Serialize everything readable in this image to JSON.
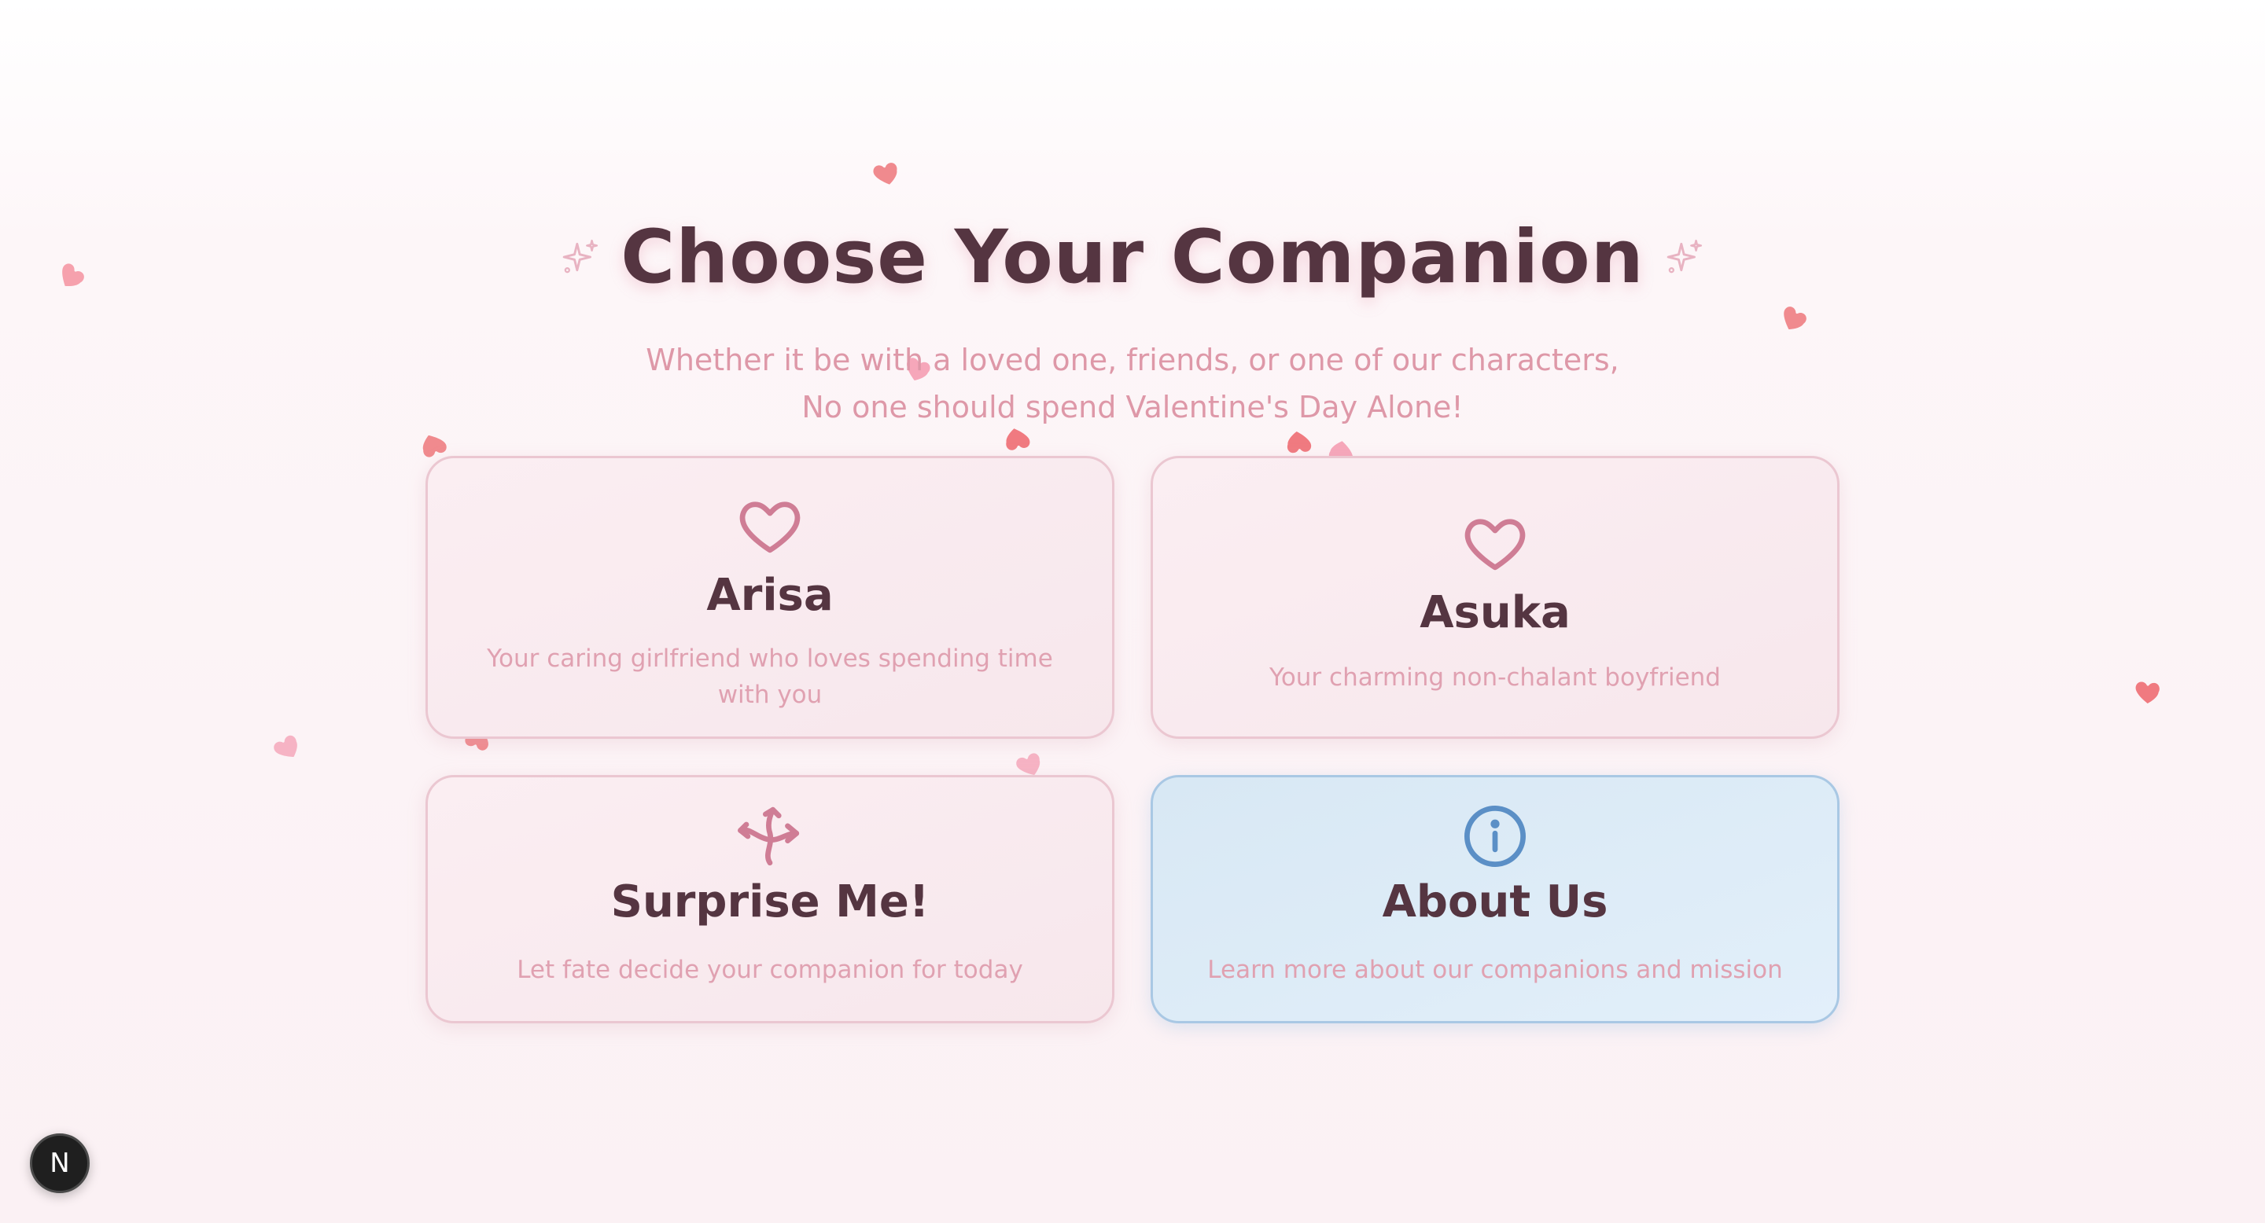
{
  "header": {
    "title": "Choose Your Companion",
    "subtitle_line1": "Whether it be with a loved one, friends, or one of our characters,",
    "subtitle_line2": "No one should spend Valentine's Day Alone!"
  },
  "cards": [
    {
      "name": "Arisa",
      "description": "Your caring girlfriend who loves spending time with you",
      "icon": "heart-icon"
    },
    {
      "name": "Asuka",
      "description": "Your charming non-chalant boyfriend",
      "icon": "heart-icon"
    },
    {
      "name": "Surprise Me!",
      "description": "Let fate decide your companion for today",
      "icon": "shuffle-icon"
    },
    {
      "name": "About Us",
      "description": "Learn more about our companions and mission",
      "icon": "info-icon"
    }
  ],
  "dev_badge": {
    "label": "N",
    "icon": "nextjs-icon"
  },
  "colors": {
    "title": "#553541",
    "subtitle": "#de98a8",
    "card_border_pink": "#ebc7d1",
    "card_border_blue": "#a9c8e4",
    "icon_pink": "#cf7d95",
    "icon_blue": "#5b8fc6",
    "heart_coral": "#f08a8e",
    "heart_pink": "#f6a7ba"
  }
}
